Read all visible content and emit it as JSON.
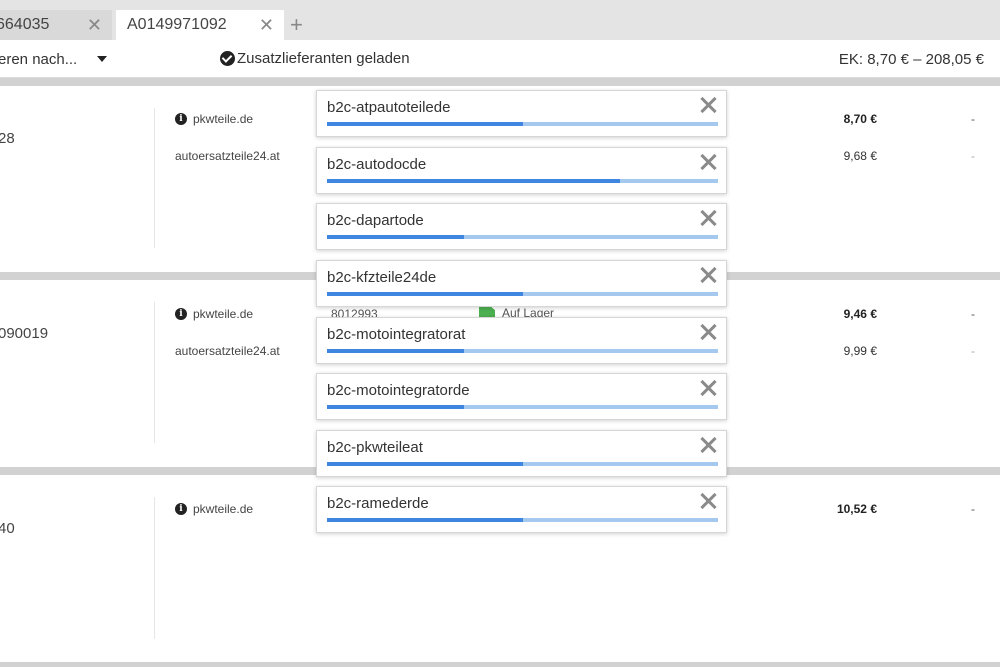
{
  "tabs": [
    {
      "label": "664035"
    },
    {
      "label": "A0149971092"
    }
  ],
  "toolbar": {
    "sort_label": "eren nach...",
    "loaded_label": "Zusatzlieferanten geladen",
    "price_range": "EK: 8,70 € – 208,05 €"
  },
  "rows": [
    {
      "number": "28",
      "shops": [
        "pkwteile.de",
        "autoersatzteile24.at"
      ],
      "prices": [
        "8,70 €",
        "9,68 €"
      ],
      "dashes": [
        "-",
        "-"
      ]
    },
    {
      "number": "090019",
      "shops": [
        "pkwteile.de",
        "autoersatzteile24.at"
      ],
      "part_number": "8012993",
      "stock": "Auf Lager",
      "prices": [
        "9,46 €",
        "9,99 €"
      ],
      "dashes": [
        "-",
        "-"
      ]
    },
    {
      "number": "40",
      "shops": [
        "pkwteile.de"
      ],
      "prices": [
        "10,52 €"
      ],
      "dashes": [
        "-"
      ]
    }
  ],
  "suppliers": [
    {
      "name": "b2c-atpautoteilede",
      "progress": 0.5
    },
    {
      "name": "b2c-autodocde",
      "progress": 0.75
    },
    {
      "name": "b2c-dapartode",
      "progress": 0.35
    },
    {
      "name": "b2c-kfzteile24de",
      "progress": 0.5
    },
    {
      "name": "b2c-motointegratorat",
      "progress": 0.35
    },
    {
      "name": "b2c-motointegratorde",
      "progress": 0.35
    },
    {
      "name": "b2c-pkwteileat",
      "progress": 0.5
    },
    {
      "name": "b2c-ramederde",
      "progress": 0.5
    }
  ],
  "colors": {
    "progress_fill": "#3f86e0",
    "progress_track": "#a5c8ef",
    "stock_green": "#4caf50"
  }
}
